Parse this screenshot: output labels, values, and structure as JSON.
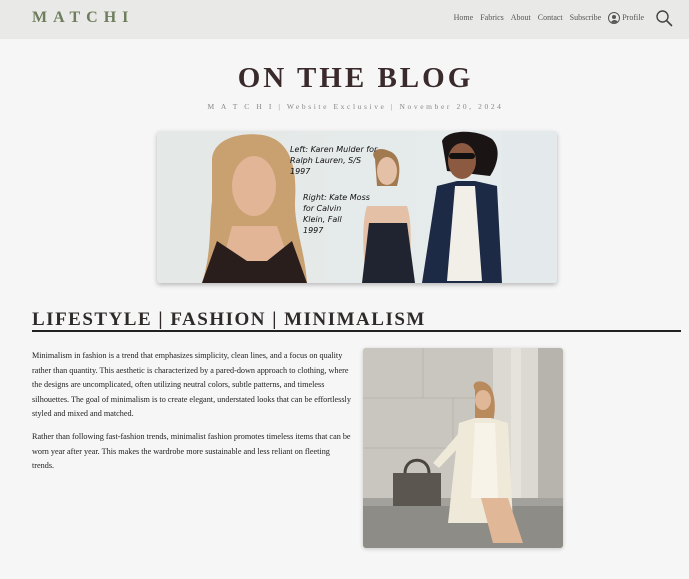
{
  "nav": {
    "logo": "MATCHI",
    "links": [
      "Home",
      "Fabrics",
      "About",
      "Contact",
      "Subscribe"
    ],
    "profile_label": "Profile"
  },
  "blog": {
    "title": "ON THE BLOG",
    "byline": "M A T C H I  |  Website Exclusive  |  November 20, 2024"
  },
  "hero": {
    "caption_left": "Left: Karen Mulder for\nRalph Lauren, S/S\n1997",
    "caption_right": "Right: Kate Moss\nfor Calvin\nKlein, Fall\n1997"
  },
  "section": {
    "heading": "LIFESTYLE | FASHION | MINIMALISM",
    "paragraphs": [
      "Minimalism in fashion is a trend that emphasizes simplicity, clean lines, and a focus on quality rather than quantity. This aesthetic is characterized by a pared-down approach to clothing, where the designs are uncomplicated, often utilizing neutral colors, subtle patterns, and timeless silhouettes. The goal of minimalism is to create elegant, understated looks that can be effortlessly styled and mixed and matched.",
      "Rather than following fast-fashion trends, minimalist fashion promotes timeless items that can be worn year after year. This makes the wardrobe more sustainable and less reliant on fleeting trends."
    ]
  },
  "colors": {
    "logo": "#6e7d5b",
    "navbar_bg": "#e9e9e7",
    "page_bg": "#f6f6f6",
    "title": "#3a2a2c"
  },
  "icons": [
    "profile-icon",
    "search-icon"
  ]
}
